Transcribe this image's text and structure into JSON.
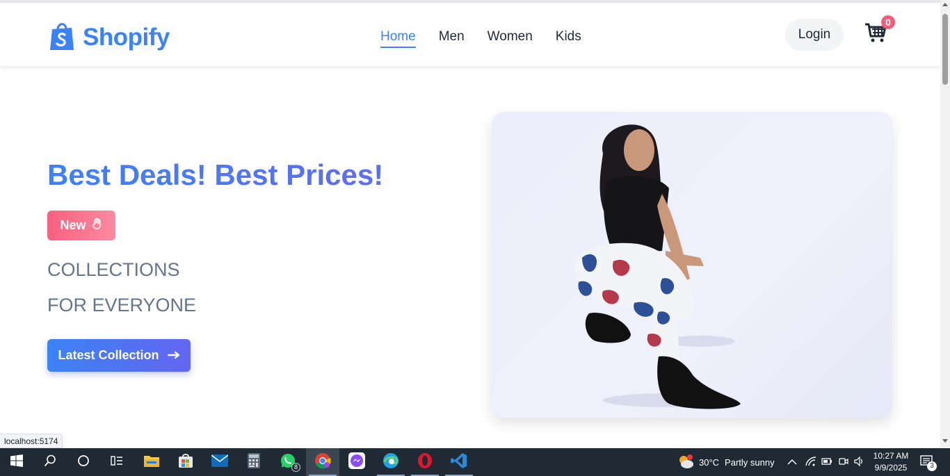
{
  "header": {
    "brand": "Shopify",
    "nav": [
      "Home",
      "Men",
      "Women",
      "Kids"
    ],
    "login_label": "Login",
    "cart_count": "0"
  },
  "hero": {
    "title": "Best Deals! Best Prices!",
    "badge": "New",
    "line1": "COLLECTIONS",
    "line2": "FOR EVERYONE",
    "cta_label": "Latest Collection"
  },
  "status_bar": {
    "url": "localhost:5174"
  },
  "taskbar": {
    "whatsapp_badge": "8",
    "weather_temp": "30°C",
    "weather_text": "Partly sunny",
    "time": "10:27 AM",
    "date": "9/9/2025",
    "notification_count": "3"
  },
  "colors": {
    "brand": "#3b82f6",
    "badge": "#f9617f",
    "cta_start": "#3b82f6",
    "cta_end": "#6366f1"
  }
}
